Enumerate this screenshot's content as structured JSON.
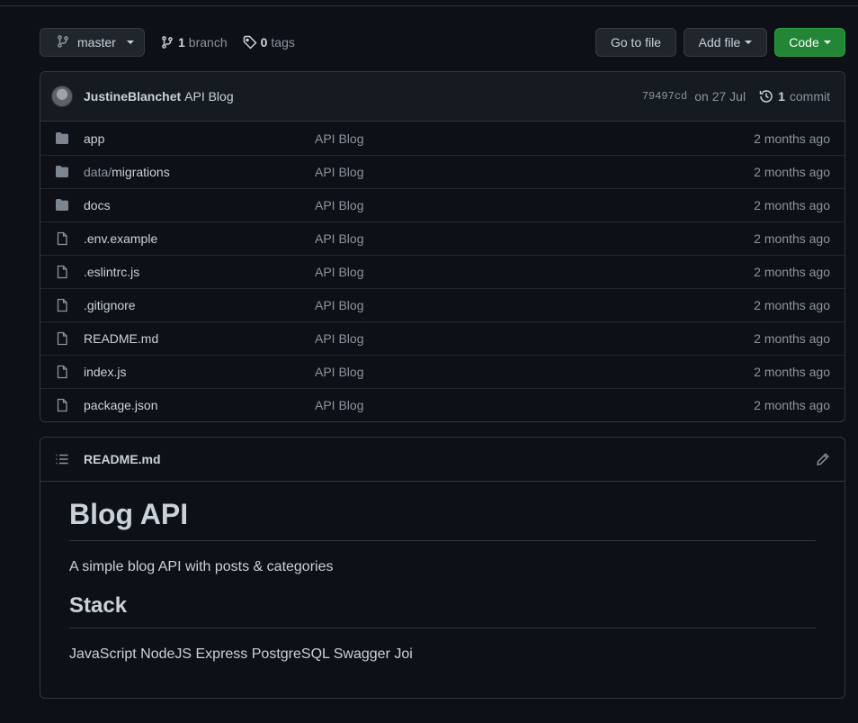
{
  "toolbar": {
    "branch_name": "master",
    "branch_count": "1",
    "branch_label": "branch",
    "tag_count": "0",
    "tag_label": "tags",
    "goto_file_label": "Go to file",
    "add_file_label": "Add file",
    "code_label": "Code"
  },
  "commit": {
    "author": "JustineBlanchet",
    "message": "API Blog",
    "sha": "79497cd",
    "date": "on 27 Jul",
    "count": "1",
    "count_label": "commit"
  },
  "files": [
    {
      "type": "dir",
      "prefix": "",
      "name": "app",
      "message": "API Blog",
      "age": "2 months ago"
    },
    {
      "type": "dir",
      "prefix": "data/",
      "name": "migrations",
      "message": "API Blog",
      "age": "2 months ago"
    },
    {
      "type": "dir",
      "prefix": "",
      "name": "docs",
      "message": "API Blog",
      "age": "2 months ago"
    },
    {
      "type": "file",
      "prefix": "",
      "name": ".env.example",
      "message": "API Blog",
      "age": "2 months ago"
    },
    {
      "type": "file",
      "prefix": "",
      "name": ".eslintrc.js",
      "message": "API Blog",
      "age": "2 months ago"
    },
    {
      "type": "file",
      "prefix": "",
      "name": ".gitignore",
      "message": "API Blog",
      "age": "2 months ago"
    },
    {
      "type": "file",
      "prefix": "",
      "name": "README.md",
      "message": "API Blog",
      "age": "2 months ago"
    },
    {
      "type": "file",
      "prefix": "",
      "name": "index.js",
      "message": "API Blog",
      "age": "2 months ago"
    },
    {
      "type": "file",
      "prefix": "",
      "name": "package.json",
      "message": "API Blog",
      "age": "2 months ago"
    }
  ],
  "readme": {
    "filename": "README.md",
    "heading": "Blog API",
    "description": "A simple blog API with posts & categories",
    "stack_heading": "Stack",
    "stack_text": "JavaScript NodeJS Express PostgreSQL Swagger Joi"
  },
  "colors": {
    "background": "#0d1117",
    "border": "#30363d",
    "green_button": "#238636",
    "muted_text": "#8b949e",
    "folder_icon": "#7d8590"
  },
  "icons": {
    "branch": "git-branch-icon",
    "tag": "tag-icon",
    "history": "history-icon",
    "folder": "folder-icon",
    "file": "file-icon",
    "list": "list-icon",
    "edit": "pencil-icon"
  }
}
